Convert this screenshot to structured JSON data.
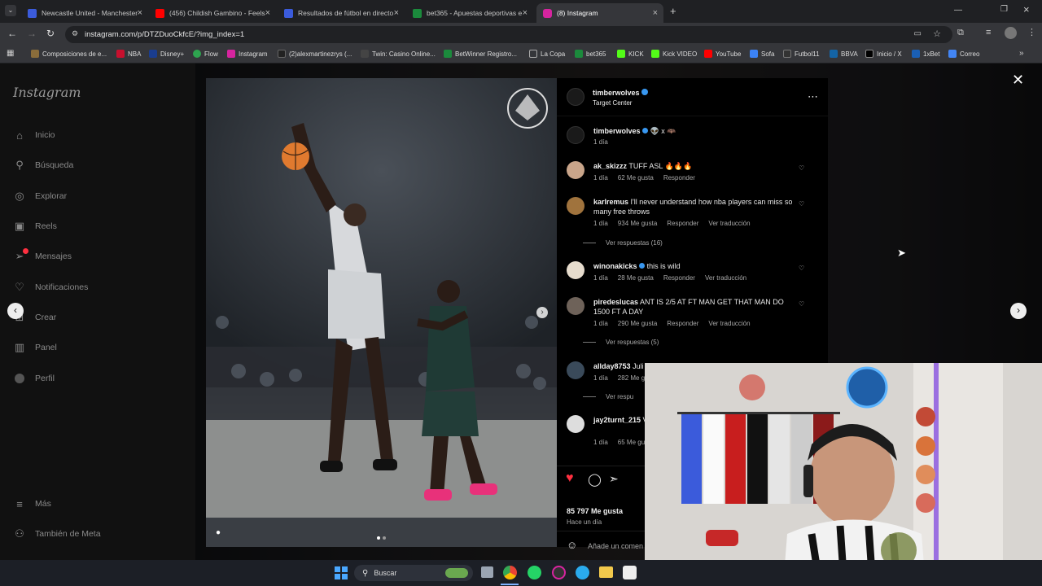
{
  "browser": {
    "tabs": [
      {
        "label": "Newcastle United - Manchester",
        "color": "#3b5bdb"
      },
      {
        "label": "(456) Childish Gambino - Feels",
        "color": "#ff0000"
      },
      {
        "label": "Resultados de fútbol en directo",
        "color": "#3b5bdb"
      },
      {
        "label": "bet365 - Apuestas deportivas e",
        "color": "#1b8a3c"
      },
      {
        "label": "(8) Instagram",
        "color": "#d6249f"
      }
    ],
    "url": "instagram.com/p/DTZDuoCkfcE/?img_index=1",
    "bookmarks": [
      {
        "label": "Composiciones de e...",
        "color": "#8a6d3b"
      },
      {
        "label": "NBA",
        "color": "#c8102e"
      },
      {
        "label": "Disney+",
        "color": "#1a3d8f"
      },
      {
        "label": "Flow",
        "color": "#2ea44f"
      },
      {
        "label": "Instagram",
        "color": "#d6249f"
      },
      {
        "label": "(2)alexmartinezrys (...",
        "color": "#222"
      },
      {
        "label": "Twin: Casino Online...",
        "color": "#444"
      },
      {
        "label": "BetWinner Registro...",
        "color": "#1b8a3c"
      },
      {
        "label": "La Copa",
        "color": "#888"
      },
      {
        "label": "bet365",
        "color": "#1b8a3c"
      },
      {
        "label": "KICK",
        "color": "#53fc18"
      },
      {
        "label": "Kick VIDEO",
        "color": "#53fc18"
      },
      {
        "label": "YouTube",
        "color": "#ff0000"
      },
      {
        "label": "Sofa",
        "color": "#3b82f6"
      },
      {
        "label": "Futbol11",
        "color": "#333"
      },
      {
        "label": "BBVA",
        "color": "#1464a5"
      },
      {
        "label": "Inicio / X",
        "color": "#000"
      },
      {
        "label": "1xBet",
        "color": "#1a5fb4"
      },
      {
        "label": "Correo",
        "color": "#4285f4"
      }
    ]
  },
  "sidebar": {
    "logo": "Instagram",
    "items": [
      {
        "label": "Inicio",
        "icon": "home-icon",
        "glyph": "⌂"
      },
      {
        "label": "Búsqueda",
        "icon": "search-icon",
        "glyph": "⚲"
      },
      {
        "label": "Explorar",
        "icon": "compass-icon",
        "glyph": "◎"
      },
      {
        "label": "Reels",
        "icon": "reels-icon",
        "glyph": "▣"
      },
      {
        "label": "Mensajes",
        "icon": "messages-icon",
        "glyph": "➢"
      },
      {
        "label": "Notificaciones",
        "icon": "heart-icon",
        "glyph": "♡"
      },
      {
        "label": "Crear",
        "icon": "plus-icon",
        "glyph": "⊞"
      },
      {
        "label": "Panel",
        "icon": "dashboard-icon",
        "glyph": "▥"
      },
      {
        "label": "Perfil",
        "icon": "profile-icon",
        "glyph": "●"
      }
    ],
    "more": "Más",
    "meta": "También de Meta"
  },
  "post": {
    "author": "timberwolves",
    "location": "Target Center",
    "caption_user": "timberwolves",
    "caption": "👽 x 🦇",
    "caption_time": "1 día",
    "likes": "85 797 Me gusta",
    "time": "Hace un día",
    "add_comment": "Añade un comen",
    "comments": [
      {
        "user": "ak_skizzz",
        "text": "TUFF ASL 🔥🔥🔥",
        "time": "1 día",
        "likes": "62 Me gusta",
        "reply": "Responder",
        "translate": "",
        "replies": "",
        "avatar": "#c9a58a"
      },
      {
        "user": "karlremus",
        "text": "I'll never understand how nba players can miss so many free throws",
        "time": "1 día",
        "likes": "934 Me gusta",
        "reply": "Responder",
        "translate": "Ver traducción",
        "replies": "Ver respuestas (16)",
        "avatar": "#a0733d"
      },
      {
        "user": "winonakicks",
        "text": "this is wild",
        "time": "1 día",
        "likes": "28 Me gusta",
        "reply": "Responder",
        "translate": "Ver traducción",
        "replies": "",
        "avatar": "#e6dccd"
      },
      {
        "user": "piredeslucas",
        "text": "ANT IS 2/5 AT FT MAN GET THAT MAN DO 1500 FT A DAY",
        "time": "1 día",
        "likes": "290 Me gusta",
        "reply": "Responder",
        "translate": "Ver traducción",
        "replies": "Ver respuestas (5)",
        "avatar": "#6e6259"
      },
      {
        "user": "allday8753",
        "text": "Juli",
        "time": "1 día",
        "likes": "282 Me gu",
        "reply": "",
        "translate": "",
        "replies": "Ver respu",
        "avatar": "#3a4a5a"
      },
      {
        "user": "jay2turnt_215",
        "text": "V",
        "time": "1 día",
        "likes": "65 Me gus",
        "reply": "",
        "translate": "",
        "replies": "",
        "avatar": "#ddd"
      }
    ]
  },
  "taskbar": {
    "search": "Buscar"
  },
  "colors": {
    "like_red": "#ff3040",
    "verified_blue": "#3897f0"
  }
}
